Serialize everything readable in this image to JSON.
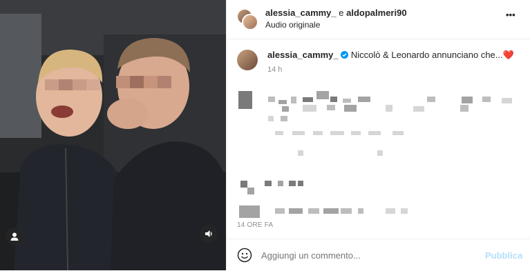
{
  "header": {
    "username_1": "alessia_cammy_",
    "conjunction": " e ",
    "username_2": "aldopalmeri90",
    "subtitle": "Audio originale",
    "more_label": "•••"
  },
  "caption": {
    "username": "alessia_cammy_",
    "text": "Niccolò & Leonardo annunciano che...❤️",
    "time": "14 h"
  },
  "footer": {
    "timestamp": "14 ORE FA",
    "comment_placeholder": "Aggiungi un commento...",
    "publish_label": "Pubblica"
  },
  "colors": {
    "verified": "#0095f6",
    "publish": "#b2dffc",
    "secondary_text": "#8e8e8e"
  }
}
